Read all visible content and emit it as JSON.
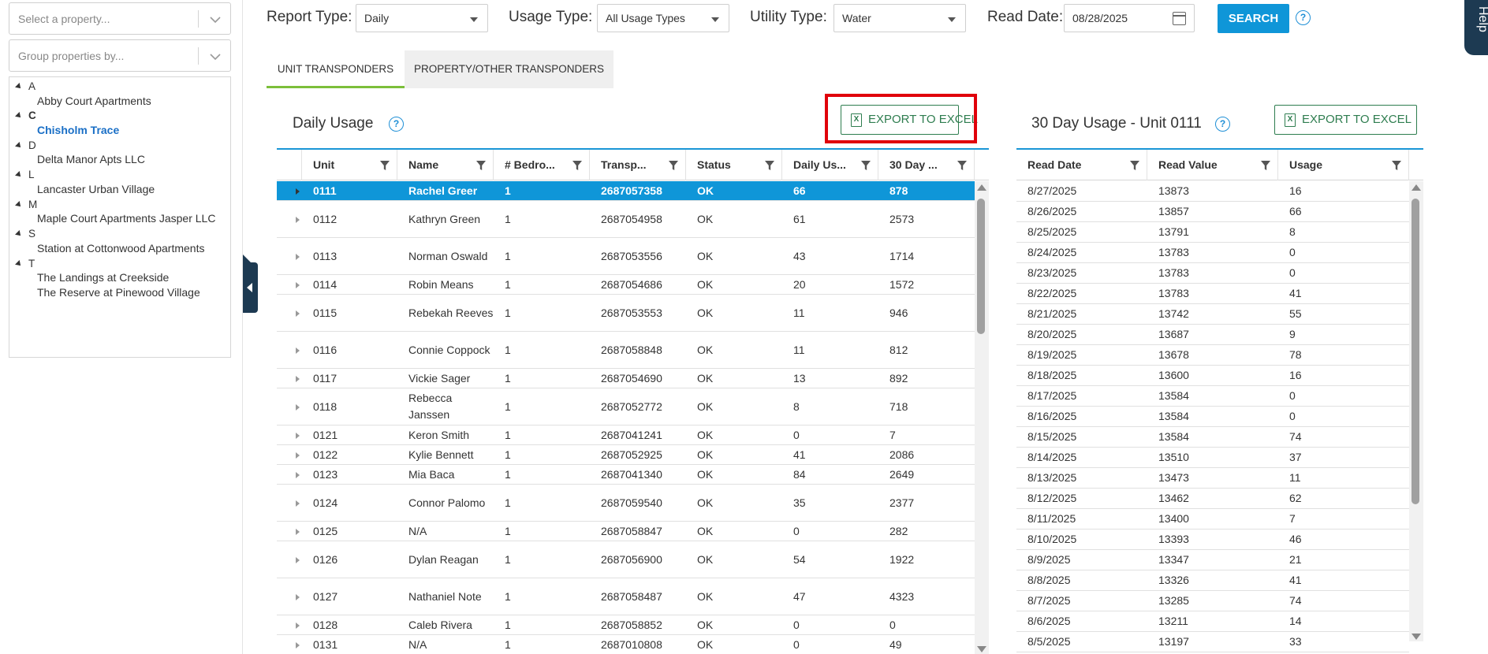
{
  "sidebar": {
    "property_placeholder": "Select a property...",
    "group_placeholder": "Group properties by...",
    "groups": [
      {
        "letter": "A",
        "properties": [
          "Abby Court Apartments"
        ]
      },
      {
        "letter": "C",
        "properties": [
          "Chisholm Trace"
        ]
      },
      {
        "letter": "D",
        "properties": [
          "Delta Manor Apts LLC"
        ]
      },
      {
        "letter": "L",
        "properties": [
          "Lancaster Urban Village"
        ]
      },
      {
        "letter": "M",
        "properties": [
          "Maple Court Apartments Jasper LLC"
        ]
      },
      {
        "letter": "S",
        "properties": [
          "Station at Cottonwood Apartments"
        ]
      },
      {
        "letter": "T",
        "properties": [
          "The Landings at Creekside",
          "The Reserve at Pinewood Village"
        ]
      }
    ],
    "selected_property": "Chisholm Trace"
  },
  "toolbar": {
    "report_type_label": "Report Type:",
    "report_type_value": "Daily",
    "usage_type_label": "Usage Type:",
    "usage_type_value": "All Usage Types",
    "utility_type_label": "Utility Type:",
    "utility_type_value": "Water",
    "read_date_label": "Read Date:",
    "read_date_value": "08/28/2025",
    "search_label": "SEARCH",
    "help_glyph": "?"
  },
  "side_help_label": "Help",
  "tabs": [
    {
      "label": "UNIT TRANSPONDERS",
      "active": true
    },
    {
      "label": "PROPERTY/OTHER TRANSPONDERS",
      "active": false
    }
  ],
  "daily": {
    "title": "Daily Usage",
    "export_label": "EXPORT TO EXCEL",
    "columns": [
      "Unit",
      "Name",
      "# Bedro...",
      "Transp...",
      "Status",
      "Daily Us...",
      "30 Day ..."
    ],
    "rows": [
      [
        "0111",
        "Rachel Greer",
        "1",
        "2687057358",
        "OK",
        "66",
        "878"
      ],
      [
        "0112",
        "Kathryn Green",
        "1",
        "2687054958",
        "OK",
        "61",
        "2573"
      ],
      [
        "0113",
        "Norman Oswald",
        "1",
        "2687053556",
        "OK",
        "43",
        "1714"
      ],
      [
        "0114",
        "Robin Means",
        "1",
        "2687054686",
        "OK",
        "20",
        "1572"
      ],
      [
        "0115",
        "Rebekah Reeves",
        "1",
        "2687053553",
        "OK",
        "11",
        "946"
      ],
      [
        "0116",
        "Connie Coppock",
        "1",
        "2687058848",
        "OK",
        "11",
        "812"
      ],
      [
        "0117",
        "Vickie Sager",
        "1",
        "2687054690",
        "OK",
        "13",
        "892"
      ],
      [
        "0118",
        "Rebecca Janssen",
        "1",
        "2687052772",
        "OK",
        "8",
        "718"
      ],
      [
        "0121",
        "Keron Smith",
        "1",
        "2687041241",
        "OK",
        "0",
        "7"
      ],
      [
        "0122",
        "Kylie Bennett",
        "1",
        "2687052925",
        "OK",
        "41",
        "2086"
      ],
      [
        "0123",
        "Mia Baca",
        "1",
        "2687041340",
        "OK",
        "84",
        "2649"
      ],
      [
        "0124",
        "Connor Palomo",
        "1",
        "2687059540",
        "OK",
        "35",
        "2377"
      ],
      [
        "0125",
        "N/A",
        "1",
        "2687058847",
        "OK",
        "0",
        "282"
      ],
      [
        "0126",
        "Dylan Reagan",
        "1",
        "2687056900",
        "OK",
        "54",
        "1922"
      ],
      [
        "0127",
        "Nathaniel Note",
        "1",
        "2687058487",
        "OK",
        "47",
        "4323"
      ],
      [
        "0128",
        "Caleb Rivera",
        "1",
        "2687058852",
        "OK",
        "0",
        "0"
      ],
      [
        "0131",
        "N/A",
        "1",
        "2687010808",
        "OK",
        "0",
        "49"
      ]
    ]
  },
  "thirty": {
    "title": "30 Day Usage - Unit 0111",
    "export_label": "EXPORT TO EXCEL",
    "columns": [
      "Read Date",
      "Read Value",
      "Usage"
    ],
    "rows": [
      [
        "8/27/2025",
        "13873",
        "16"
      ],
      [
        "8/26/2025",
        "13857",
        "66"
      ],
      [
        "8/25/2025",
        "13791",
        "8"
      ],
      [
        "8/24/2025",
        "13783",
        "0"
      ],
      [
        "8/23/2025",
        "13783",
        "0"
      ],
      [
        "8/22/2025",
        "13783",
        "41"
      ],
      [
        "8/21/2025",
        "13742",
        "55"
      ],
      [
        "8/20/2025",
        "13687",
        "9"
      ],
      [
        "8/19/2025",
        "13678",
        "78"
      ],
      [
        "8/18/2025",
        "13600",
        "16"
      ],
      [
        "8/17/2025",
        "13584",
        "0"
      ],
      [
        "8/16/2025",
        "13584",
        "0"
      ],
      [
        "8/15/2025",
        "13584",
        "74"
      ],
      [
        "8/14/2025",
        "13510",
        "37"
      ],
      [
        "8/13/2025",
        "13473",
        "11"
      ],
      [
        "8/12/2025",
        "13462",
        "62"
      ],
      [
        "8/11/2025",
        "13400",
        "7"
      ],
      [
        "8/10/2025",
        "13393",
        "46"
      ],
      [
        "8/9/2025",
        "13347",
        "21"
      ],
      [
        "8/8/2025",
        "13326",
        "41"
      ],
      [
        "8/7/2025",
        "13285",
        "74"
      ],
      [
        "8/6/2025",
        "13211",
        "14"
      ],
      [
        "8/5/2025",
        "13197",
        "33"
      ]
    ]
  },
  "colors": {
    "accent": "#0f96d8",
    "tab_underline": "#7cbf3a",
    "export": "#2e7d4f",
    "highlight_box": "#e0000b",
    "nav": "#1d3a52"
  }
}
